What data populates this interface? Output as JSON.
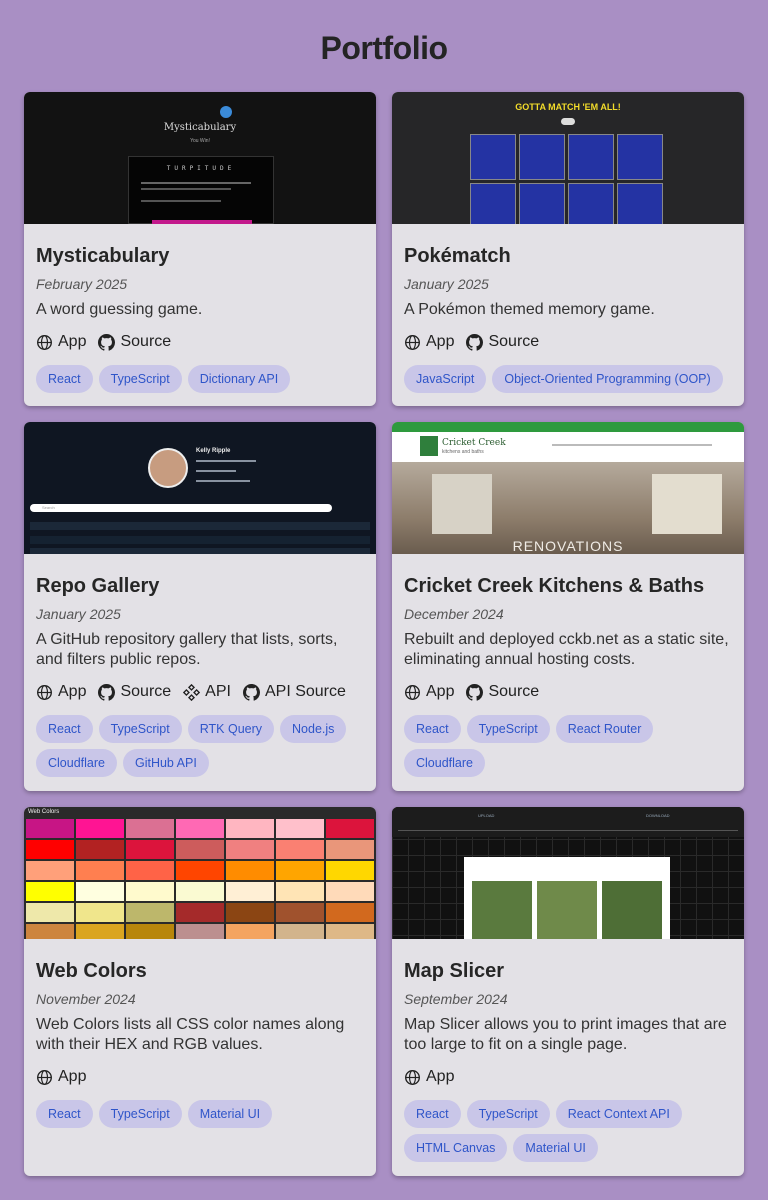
{
  "page": {
    "title": "Portfolio"
  },
  "projects": [
    {
      "title": "Mysticabulary",
      "date": "February 2025",
      "description": "A word guessing game.",
      "links": [
        "App",
        "Source"
      ],
      "tags": [
        "React",
        "TypeScript",
        "Dictionary API"
      ],
      "thumb": {
        "heading": "Mysticabulary",
        "hint": "You Win!",
        "word": "TURPITUDE"
      }
    },
    {
      "title": "Pokématch",
      "date": "January 2025",
      "description": "A Pokémon themed memory game.",
      "links": [
        "App",
        "Source"
      ],
      "tags": [
        "JavaScript",
        "Object-Oriented Programming (OOP)"
      ],
      "thumb": {
        "heading": "GOTTA MATCH 'EM ALL!"
      }
    },
    {
      "title": "Repo Gallery",
      "date": "January 2025",
      "description": "A GitHub repository gallery that lists, sorts, and filters public repos.",
      "links": [
        "App",
        "Source",
        "API",
        "API Source"
      ],
      "tags": [
        "React",
        "TypeScript",
        "RTK Query",
        "Node.js",
        "Cloudflare",
        "GitHub API"
      ],
      "thumb": {
        "heading": "Kelly Ripple",
        "search_placeholder": "Search"
      }
    },
    {
      "title": "Cricket Creek Kitchens & Baths",
      "date": "December 2024",
      "description": "Rebuilt and deployed cckb.net as a static site, eliminating annual hosting costs.",
      "links": [
        "App",
        "Source"
      ],
      "tags": [
        "React",
        "TypeScript",
        "React Router",
        "Cloudflare"
      ],
      "thumb": {
        "heading": "Cricket Creek",
        "subheading": "kitchens and baths",
        "overlay": "RENOVATIONS"
      }
    },
    {
      "title": "Web Colors",
      "date": "November 2024",
      "description": "Web Colors lists all CSS color names along with their HEX and RGB values.",
      "links": [
        "App"
      ],
      "tags": [
        "React",
        "TypeScript",
        "Material UI"
      ],
      "thumb": {
        "heading": "Web Colors"
      }
    },
    {
      "title": "Map Slicer",
      "date": "September 2024",
      "description": "Map Slicer allows you to print images that are too large to fit on a single page.",
      "links": [
        "App"
      ],
      "tags": [
        "React",
        "TypeScript",
        "React Context API",
        "HTML Canvas",
        "Material UI"
      ],
      "thumb": {
        "upload": "UPLOAD",
        "download": "DOWNLOAD"
      }
    }
  ],
  "icons": {
    "App": "globe-icon",
    "Source": "github-icon",
    "API": "api-icon",
    "API Source": "github-icon"
  },
  "colors": {
    "background": "#a98fc4",
    "card": "#e3e1e6",
    "tag_bg": "#c9c6e8",
    "tag_text": "#2f55c9"
  }
}
